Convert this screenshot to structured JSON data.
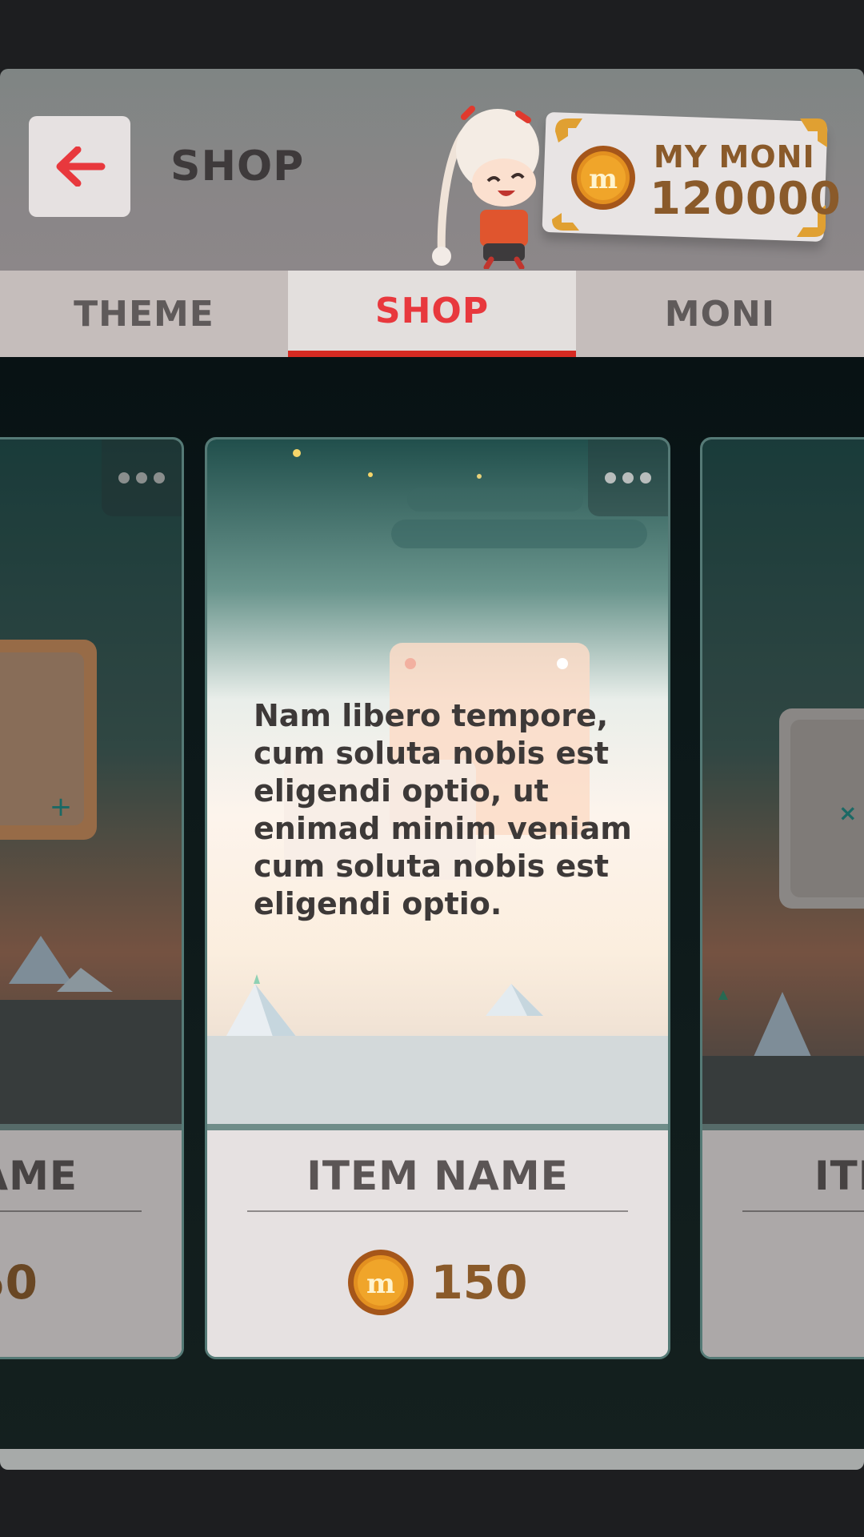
{
  "header": {
    "title": "SHOP",
    "back_icon": "arrow-left-icon",
    "wallet_label": "MY MONI",
    "wallet_amount": "120000"
  },
  "tabs": [
    {
      "label": "THEME",
      "active": false
    },
    {
      "label": "SHOP",
      "active": true
    },
    {
      "label": "MONI",
      "active": false
    }
  ],
  "cards": [
    {
      "name": "AME",
      "price": "50",
      "position": "left-partial"
    },
    {
      "name": "ITEM NAME",
      "price": "150",
      "position": "center",
      "description": "Nam libero tempore, cum soluta nobis est eligendi optio, ut enimad minim veniam cum soluta nobis est eligendi optio."
    },
    {
      "name": "ITE",
      "position": "right-partial"
    }
  ],
  "colors": {
    "accent": "#e8383d",
    "tab_underline": "#d62a22",
    "coin": "#d88a1c",
    "price_text": "#8a5a2a"
  }
}
